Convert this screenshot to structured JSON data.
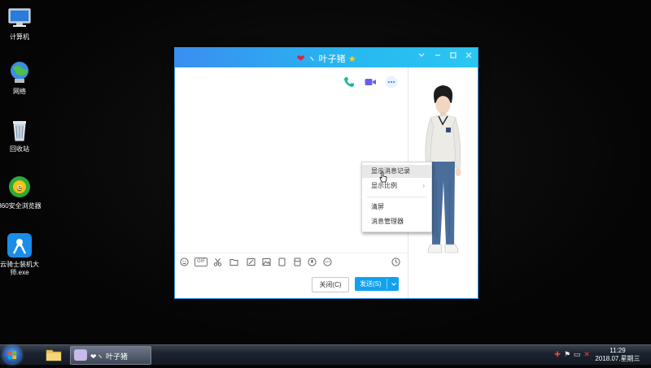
{
  "desktop": {
    "icons": [
      {
        "label": "计算机",
        "icon": "computer-icon"
      },
      {
        "label": "网络",
        "icon": "network-icon"
      },
      {
        "label": "回收站",
        "icon": "recycle-bin-icon"
      },
      {
        "label": "360安全浏览器",
        "icon": "browser-360-icon"
      },
      {
        "label": "云骑士装机大师.exe",
        "icon": "yunqishi-icon"
      }
    ]
  },
  "chat_window": {
    "title_prefix": "❤",
    "title_text": "ヽ 叶子猪",
    "title_suffix": "★",
    "window_controls": [
      "chevron-down-icon",
      "minimize-icon",
      "maximize-icon",
      "close-icon"
    ],
    "top_actions": [
      "phone-icon",
      "video-icon",
      "more-icon"
    ],
    "toolbar_icons": [
      "emoji-icon",
      "gif-icon",
      "scissors-icon",
      "folder-icon",
      "image-edit-icon",
      "picture-icon",
      "screen-icon",
      "red-packet-icon",
      "voice-icon",
      "more-circle-icon",
      "history-clock-icon"
    ],
    "gif_label": "GIF",
    "close_button": "关闭(C)",
    "send_button": "发送(S)"
  },
  "context_menu": {
    "items": [
      {
        "label": "显示消息记录",
        "highlighted": true
      },
      {
        "label": "显示比例",
        "has_submenu": true
      },
      {
        "label": "清屏"
      },
      {
        "label": "消息管理器"
      }
    ]
  },
  "taskbar": {
    "task_label": "❤ヽ 叶子猪",
    "time": "11:29",
    "date": "2018.07.星期三"
  },
  "colors": {
    "titlebar_start": "#3a8ef0",
    "titlebar_end": "#2ac6f2",
    "send_button": "#12a0f0",
    "accent_green": "#16b998",
    "accent_purple": "#6a5ee8"
  }
}
